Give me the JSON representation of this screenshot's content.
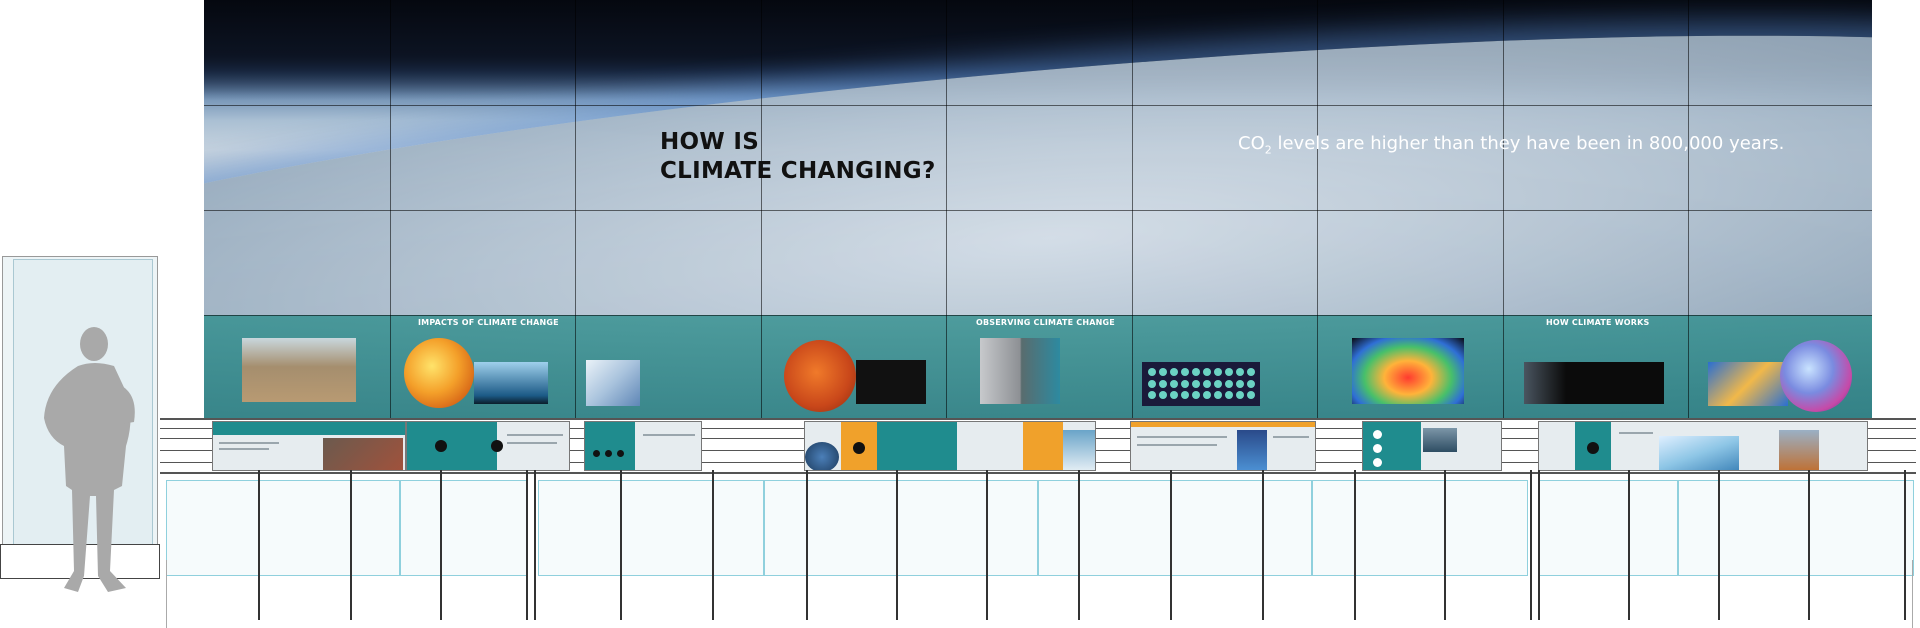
{
  "wall": {
    "title_line1": "HOW IS",
    "title_line2": "CLIMATE CHANGING?",
    "fact_prefix": "CO",
    "fact_sub": "2",
    "fact_rest": " levels are higher than they have been in 800,000 years."
  },
  "sections": [
    {
      "label": "IMPACTS OF CLIMATE CHANGE"
    },
    {
      "label": "OBSERVING CLIMATE CHANGE"
    },
    {
      "label": "HOW CLIMATE WORKS"
    }
  ],
  "colors": {
    "teal": "#1f8c8e",
    "orange": "#f0a12b",
    "glass": "#8fd0dd"
  }
}
